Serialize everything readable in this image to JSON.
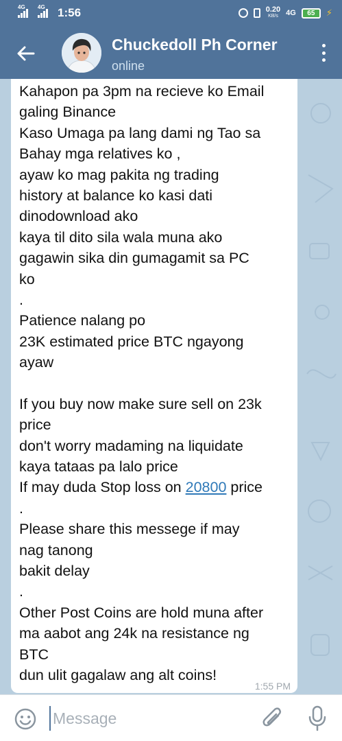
{
  "status_bar": {
    "network_1": "4G",
    "network_2": "4G",
    "time": "1:56",
    "speed": "0.20",
    "speed_unit": "KB/s",
    "network_3": "4G",
    "battery": "65"
  },
  "header": {
    "title": "Chuckedoll Ph Corner",
    "status": "online"
  },
  "message": {
    "lines": [
      "Kahapon pa 3pm na recieve ko Email",
      "galing Binance",
      "Kaso Umaga pa lang dami ng Tao sa",
      "Bahay mga relatives ko ,",
      "ayaw ko mag pakita ng trading",
      "history at balance ko kasi dati",
      "dinodownload ako",
      "kaya til dito sila wala muna ako",
      "gagawin sika din gumagamit sa PC",
      "ko",
      ".",
      "Patience nalang po",
      "23K estimated price BTC ngayong",
      "ayaw",
      "",
      "If you buy now make sure sell on 23k",
      "price",
      "don't worry madaming na liquidate",
      "kaya tataas pa lalo price"
    ],
    "stoploss_prefix": "If may duda Stop loss on ",
    "stoploss_link": "20800",
    "stoploss_suffix": " price",
    "lines_after": [
      ".",
      "Please share this messege if may",
      "nag tanong",
      "bakit delay",
      ".",
      "Other Post Coins are hold muna after",
      "ma aabot ang 24k na resistance ng",
      "BTC",
      "dun ulit gagalaw ang alt coins!"
    ],
    "time": "1:55 PM"
  },
  "input": {
    "placeholder": "Message"
  }
}
